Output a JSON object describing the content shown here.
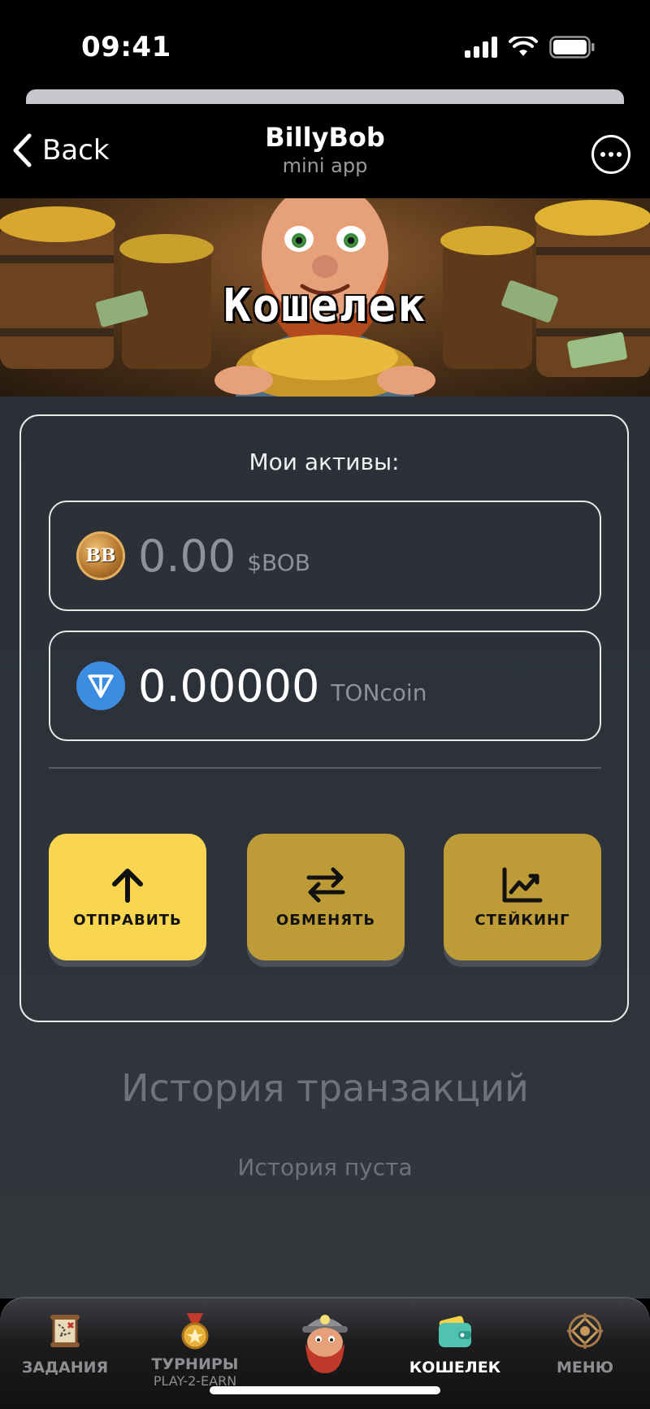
{
  "status_bar": {
    "time": "09:41"
  },
  "header": {
    "back_label": "Back",
    "title": "BillyBob",
    "subtitle": "mini app"
  },
  "banner": {
    "title": "Кошелек"
  },
  "assets": {
    "title": "Мои активы:",
    "items": [
      {
        "icon": "bob-coin-icon",
        "icon_text": "BB",
        "amount": "0.00",
        "unit": "$BOB"
      },
      {
        "icon": "ton-coin-icon",
        "amount": "0.00000",
        "unit": "TONcoin"
      }
    ]
  },
  "actions": [
    {
      "label": "ОТПРАВИТЬ",
      "icon": "arrow-up-icon",
      "color": "#f9d64f"
    },
    {
      "label": "ОБМЕНЯТЬ",
      "icon": "swap-arrows-icon",
      "color": "#bd9b37"
    },
    {
      "label": "СТЕЙКИНГ",
      "icon": "chart-up-icon",
      "color": "#bd9b37"
    }
  ],
  "history": {
    "title": "История транзакций",
    "empty_text": "История пуста"
  },
  "tabs": [
    {
      "label": "ЗАДАНИЯ",
      "icon": "scroll-map-icon"
    },
    {
      "label": "ТУРНИРЫ",
      "sublabel": "PLAY-2-EARN",
      "icon": "medal-icon"
    },
    {
      "label": "",
      "icon": "miner-avatar-icon"
    },
    {
      "label": "КОШЕЛЕК",
      "icon": "wallet-icon",
      "active": true
    },
    {
      "label": "МЕНЮ",
      "icon": "ornament-menu-icon"
    }
  ],
  "colors": {
    "accent_active": "#f9d64f",
    "accent": "#bd9b37",
    "background": "#2b3038"
  }
}
